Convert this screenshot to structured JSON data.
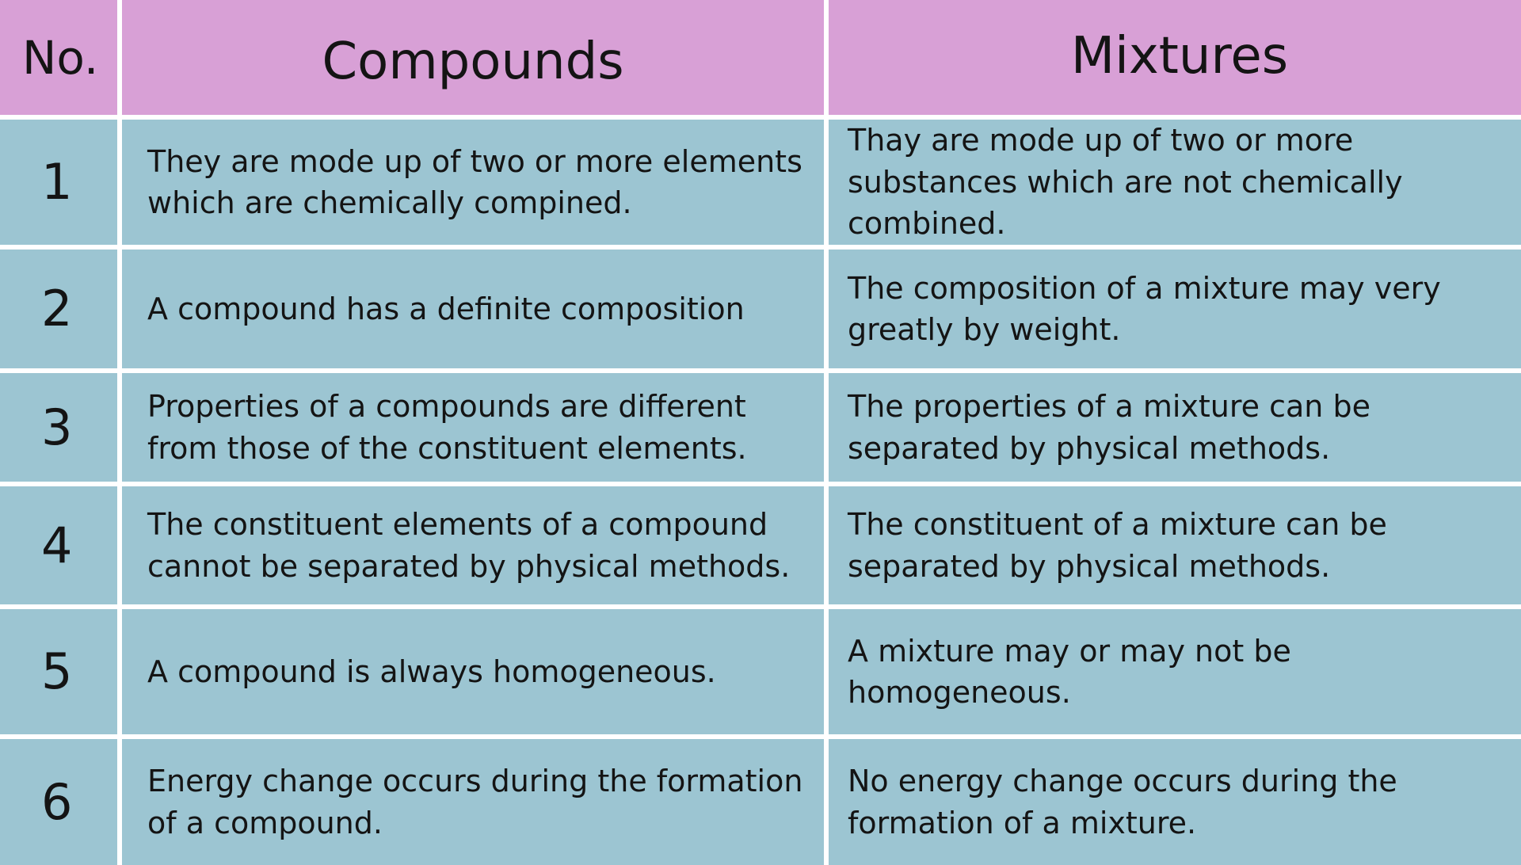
{
  "headers": {
    "no": "No.",
    "compounds": "Compounds",
    "mixtures": "Mixtures"
  },
  "rows": [
    {
      "no": "1",
      "compound": "They are mode up of two or more elements which are chemically compined.",
      "mixture": "Thay are mode up of two or more substances which are not chemically combined."
    },
    {
      "no": "2",
      "compound": "A compound has a definite composition",
      "mixture": "The composition of a mixture may very greatly by weight."
    },
    {
      "no": "3",
      "compound": "Properties of a compounds are different from those of the constituent elements.",
      "mixture": "The properties of a mixture can be separated by physical methods."
    },
    {
      "no": "4",
      "compound": "The constituent elements of a compound cannot be separated by physical methods.",
      "mixture": "The constituent of a mixture can be separated by physical methods."
    },
    {
      "no": "5",
      "compound": "A compound is always homogeneous.",
      "mixture": "A mixture may or may not be homogeneous."
    },
    {
      "no": "6",
      "compound": "Energy change occurs during the formation of a compound.",
      "mixture": "No energy change occurs during the formation of a mixture."
    }
  ],
  "colors": {
    "header_bg": "#d8a0d6",
    "row_bg": "#9cc5d2",
    "grid_lines": "#ffffff",
    "text": "#141414"
  }
}
